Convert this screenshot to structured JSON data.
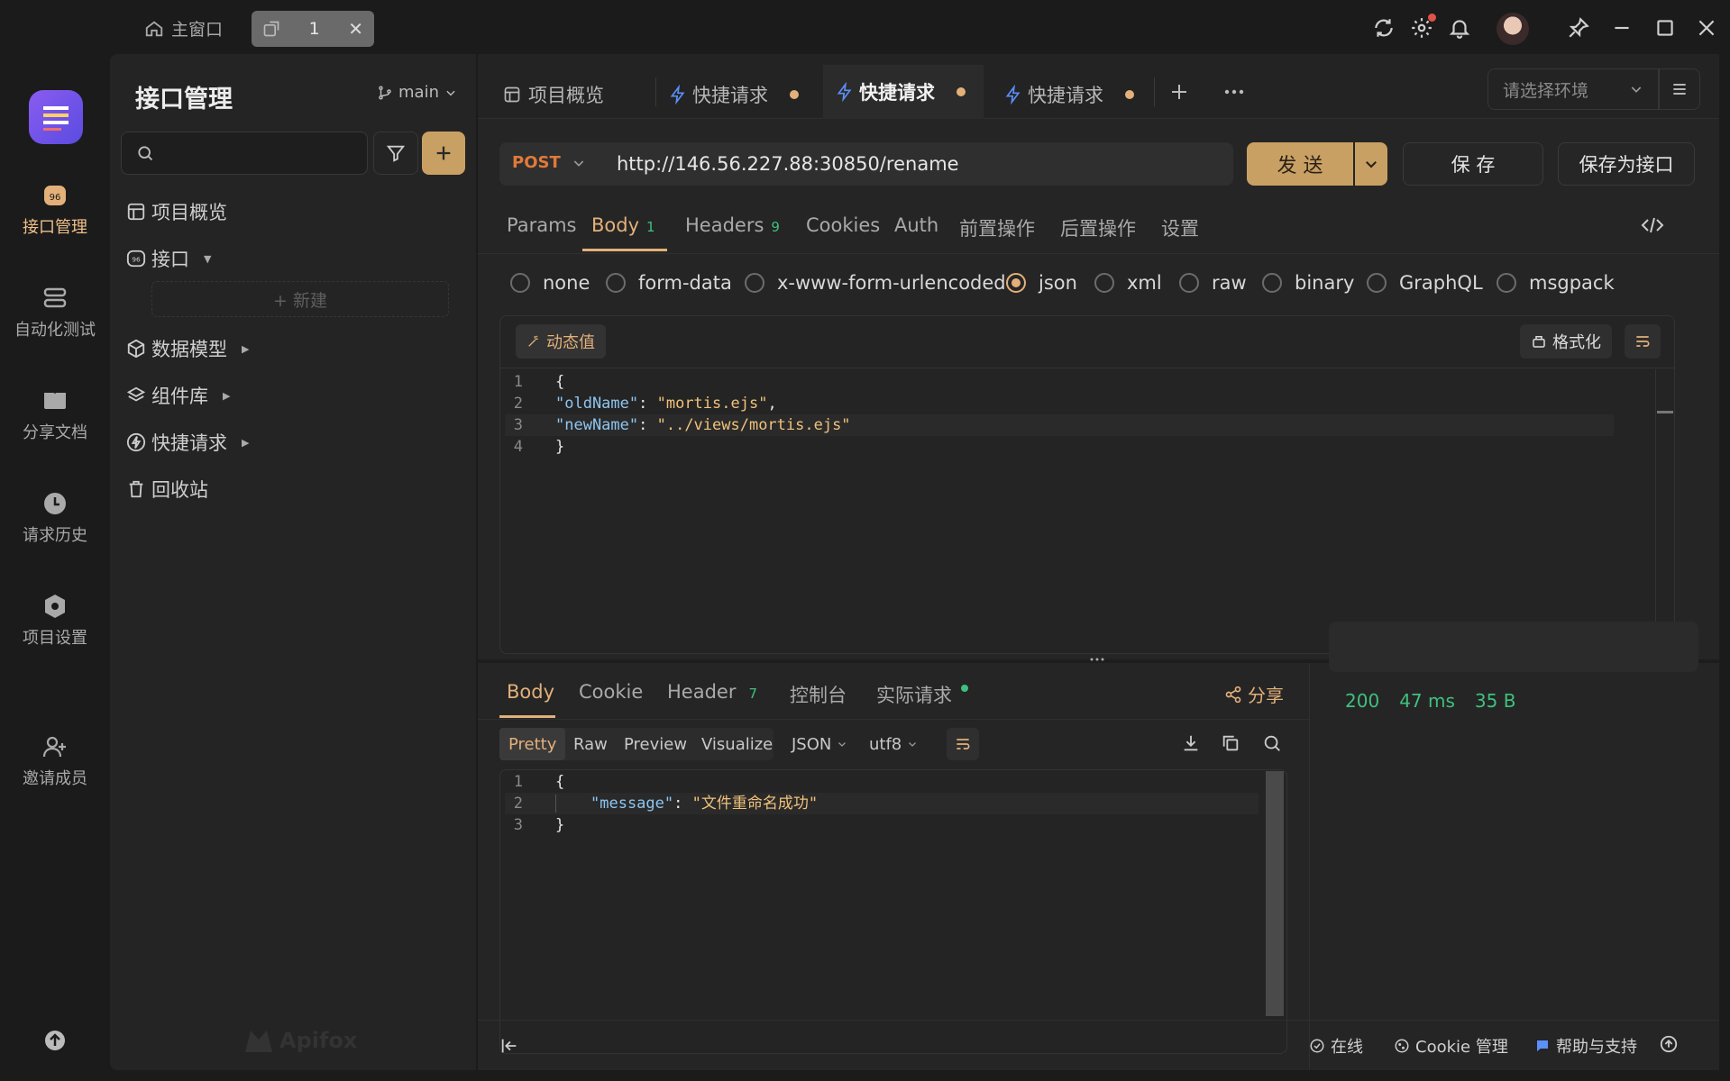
{
  "titlebar": {
    "home_tab": "主窗口",
    "active_tab": "1"
  },
  "rail": {
    "items": [
      {
        "label": "接口管理",
        "icon": "api-management-icon"
      },
      {
        "label": "自动化测试",
        "icon": "automation-test-icon"
      },
      {
        "label": "分享文档",
        "icon": "share-doc-icon"
      },
      {
        "label": "请求历史",
        "icon": "history-icon"
      },
      {
        "label": "项目设置",
        "icon": "project-settings-icon"
      },
      {
        "label": "邀请成员",
        "icon": "invite-member-icon"
      }
    ]
  },
  "sidebar": {
    "title": "接口管理",
    "branch": "main",
    "items": [
      {
        "label": "项目概览"
      },
      {
        "label": "接口"
      },
      {
        "label": "+ 新建"
      },
      {
        "label": "数据模型"
      },
      {
        "label": "组件库"
      },
      {
        "label": "快捷请求"
      },
      {
        "label": "回收站"
      }
    ],
    "watermark": "Apifox"
  },
  "tabs": {
    "items": [
      {
        "label": "项目概览"
      },
      {
        "label": "快捷请求"
      },
      {
        "label": "快捷请求"
      },
      {
        "label": "快捷请求"
      }
    ],
    "env_placeholder": "请选择环境"
  },
  "request": {
    "method": "POST",
    "url": "http://146.56.227.88:30850/rename",
    "send_label": "发 送",
    "save_label": "保 存",
    "save_as_label": "保存为接口"
  },
  "subtabs": {
    "params": "Params",
    "body": "Body",
    "body_count": "1",
    "headers": "Headers",
    "headers_count": "9",
    "cookies": "Cookies",
    "auth": "Auth",
    "pre_ops": "前置操作",
    "post_ops": "后置操作",
    "settings": "设置"
  },
  "body_types": {
    "options": [
      "none",
      "form-data",
      "x-www-form-urlencoded",
      "json",
      "xml",
      "raw",
      "binary",
      "GraphQL",
      "msgpack"
    ],
    "selected": "json"
  },
  "editor": {
    "dynamic_value": "动态值",
    "format": "格式化",
    "lines": [
      {
        "n": "1",
        "text": "{"
      },
      {
        "n": "2",
        "key": "\"oldName\"",
        "value": "\"mortis.ejs\"",
        "tail": ","
      },
      {
        "n": "3",
        "key": "\"newName\"",
        "value": "\"../views/mortis.ejs\"",
        "tail": ""
      },
      {
        "n": "4",
        "text": "}"
      }
    ]
  },
  "response": {
    "tabs": {
      "body": "Body",
      "cookie": "Cookie",
      "header": "Header",
      "header_count": "7",
      "console": "控制台",
      "actual_request": "实际请求",
      "share": "分享"
    },
    "view_modes": [
      "Pretty",
      "Raw",
      "Preview",
      "Visualize"
    ],
    "format": "JSON",
    "encoding": "utf8",
    "lines": [
      {
        "n": "1",
        "text": "{"
      },
      {
        "n": "2",
        "key": "\"message\"",
        "value": "\"文件重命名成功\""
      },
      {
        "n": "3",
        "text": "}"
      }
    ],
    "status": "200",
    "time": "47 ms",
    "size": "35 B"
  },
  "footer": {
    "online": "在线",
    "cookie_manage": "Cookie 管理",
    "help": "帮助与支持"
  },
  "colors": {
    "accent": "#e3b07a",
    "send_bg": "#c9a063",
    "success": "#3fc07e",
    "key": "#8ec5f0",
    "string": "#f0c27a"
  }
}
